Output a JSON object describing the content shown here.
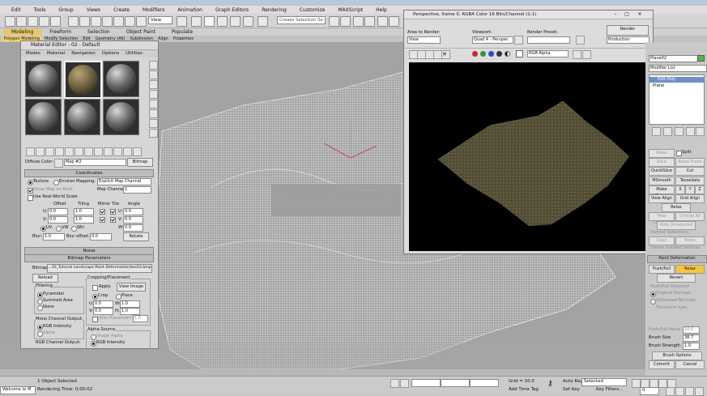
{
  "app": {
    "title": ""
  },
  "menubar": {
    "items": [
      "Edit",
      "Tools",
      "Group",
      "Views",
      "Create",
      "Modifiers",
      "Animation",
      "Graph Editors",
      "Rendering",
      "Customize",
      "MAXScript",
      "Help"
    ]
  },
  "toolbar": {
    "view_dropdown": "View",
    "selection_set_placeholder": "Create Selection Se"
  },
  "ribbon": {
    "tabs": [
      "Modeling",
      "Freeform",
      "Selection",
      "Object Paint",
      "Populate"
    ],
    "active_tab": "Modeling",
    "sub_items": [
      "Polygon Modeling",
      "Modify Selection",
      "Edit",
      "Geometry (All)",
      "Subdivision",
      "Align",
      "Properties"
    ]
  },
  "material_editor": {
    "title": "Material Editor - 02 - Default",
    "menu": [
      "Modes",
      "Material",
      "Navigation",
      "Options",
      "Utilities"
    ],
    "diffuse_label": "Diffuse Color:",
    "map_name": "Map #2",
    "map_type": "Bitmap",
    "rollouts": {
      "coordinates": "Coordinates",
      "noise": "Noise",
      "bitmap_params": "Bitmap Parameters"
    },
    "coordinates": {
      "texture": "Texture",
      "environ": "Environ",
      "mapping_label": "Mapping:",
      "mapping": "Explicit Map Channel",
      "show_map_on_back": "Show Map on Back",
      "map_channel_label": "Map Channel:",
      "map_channel": "1",
      "use_real_world": "Use Real-World Scale",
      "offset": "Offset",
      "tiling": "Tiling",
      "mirror_tile": "Mirror Tile",
      "angle": "Angle",
      "u_label": "U:",
      "v_label": "V:",
      "w_label": "W:",
      "u_offset": "0.0",
      "v_offset": "0.0",
      "u_tiling": "1.0",
      "v_tiling": "1.0",
      "u_angle": "0.0",
      "v_angle": "0.0",
      "w_angle": "0.0",
      "uv": "UV",
      "vw": "VW",
      "wu": "WU",
      "blur_label": "Blur:",
      "blur": "1.0",
      "blur_offset_label": "Blur offset:",
      "blur_offset": "0.0",
      "rotate": "Rotate"
    },
    "bitmap": {
      "bitmap_label": "Bitmap:",
      "path": "...10_Tutorial Landscape Paint Deformation\\tex03.bmp",
      "reload": "Reload",
      "cropping": "Cropping/Placement",
      "apply": "Apply",
      "view_image": "View Image",
      "crop": "Crop",
      "place": "Place",
      "u_val": "0.0",
      "w_val": "1.0",
      "v_val": "0.0",
      "h_val": "1.0",
      "u_label": "U:",
      "v_label": "V:",
      "w_label": "W:",
      "h_label": "H:",
      "jitter": "Jitter Placement:",
      "jitter_val": "1.0",
      "filtering": "Filtering",
      "pyramidal": "Pyramidal",
      "summed_area": "Summed Area",
      "none": "None",
      "mono_output": "Mono Channel Output:",
      "rgb_intensity": "RGB Intensity",
      "alpha": "Alpha",
      "rgb_output": "RGB Channel Output:",
      "alpha_source": "Alpha Source",
      "image_alpha": "Image Alpha",
      "rgb_intensity2": "RGB Intensity",
      "none2": "None (Opaque)"
    }
  },
  "render_frame": {
    "title": "Perspective, frame 0, RGBA Color 16 Bits/Channel (1:1)",
    "area_label": "Area to Render:",
    "area": "View",
    "viewport_label": "Viewport:",
    "viewport": "Quad 4 - Perspec",
    "preset_label": "Render Preset:",
    "preset": "",
    "render_btn": "Render",
    "mode": "Production",
    "channel": "RGB Alpha"
  },
  "command_panel": {
    "object_name": "Plane02",
    "modifier_list": "Modifier List",
    "stack": [
      "Edit Poly",
      "Plane"
    ],
    "buttons": {
      "make_planar": "Make Planar",
      "split": "Split",
      "reset_plane": "Reset Plane",
      "slice": "Slice",
      "quickslice": "QuickSlice",
      "cut": "Cut",
      "msmooth": "MSmooth",
      "tessellate": "Tessellate",
      "make_planar2": "Make Planar",
      "x": "X",
      "y": "Y",
      "z": "Z",
      "view_align": "View Align",
      "grid_align": "Grid Align",
      "relax": "Relax",
      "hide_selected": "Hide Selected",
      "unhide_all": "Unhide All",
      "hide_unselected": "Hide Unselected",
      "named_selections": "Named Selections:",
      "copy": "Copy",
      "paste": "Paste",
      "delete_isolated": "Delete Isolated Vertices",
      "paint_deformation": "Paint Deformation",
      "push_pull": "Push/Pull",
      "relax2": "Relax",
      "revert": "Revert",
      "direction": "Push/Pull Direction",
      "original_normals": "Original Normals",
      "deformed_normals": "Deformed Normals",
      "transform_axis": "Transform axis",
      "push_pull_value_label": "Push/Pull Value",
      "push_pull_value": "10.0",
      "brush_size_label": "Brush Size",
      "brush_size": "38.7",
      "brush_strength_label": "Brush Strength",
      "brush_strength": "1.0",
      "brush_options": "Brush Options",
      "commit": "Commit",
      "cancel": "Cancel"
    }
  },
  "status": {
    "welcome": "Welcome to M",
    "selected": "1 Object Selected",
    "rendering_time": "Rendering Time: 0:00:02",
    "grid": "Grid = 10.0",
    "add_time_tag": "Add Time Tag",
    "auto_key": "Auto Key",
    "selected_mode": "Selected",
    "set_key": "Set Key",
    "key_filters": "Key Filters...",
    "frame": "0"
  },
  "colors": {
    "ribbon_active": "#efc560",
    "render_bg": "#000000",
    "viewport_bg": "#a3a3a3",
    "paint_active": "#f5c542"
  }
}
